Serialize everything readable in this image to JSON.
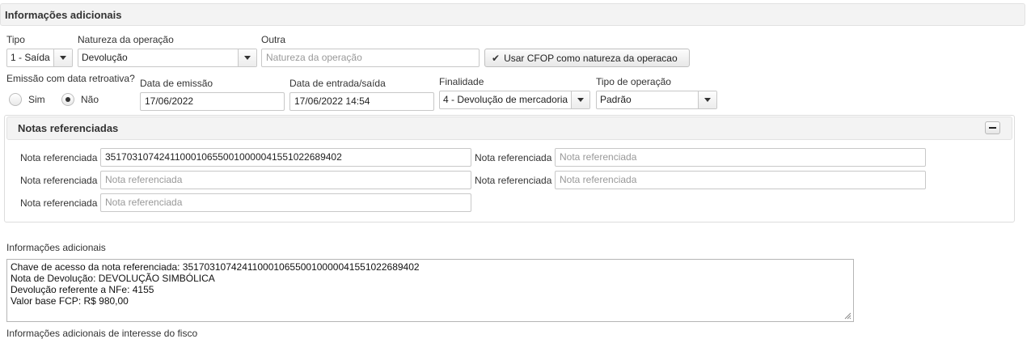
{
  "header": {
    "title": "Informações adicionais"
  },
  "tipo": {
    "label": "Tipo",
    "value": "1 - Saída"
  },
  "natureza": {
    "label": "Natureza da operação",
    "value": "Devolução"
  },
  "outra": {
    "label": "Outra",
    "placeholder": "Natureza da operação"
  },
  "cfop_button": {
    "label": "Usar CFOP como natureza da operacao"
  },
  "retroativa": {
    "label": "Emissão com data retroativa?",
    "options": [
      {
        "label": "Sim",
        "selected": false
      },
      {
        "label": "Não",
        "selected": true
      }
    ]
  },
  "data_emissao": {
    "label": "Data de emissão",
    "value": "17/06/2022"
  },
  "data_entrada": {
    "label": "Data de entrada/saída",
    "value": "17/06/2022 14:54"
  },
  "finalidade": {
    "label": "Finalidade",
    "value": "4 - Devolução de mercadoria"
  },
  "tipo_operacao": {
    "label": "Tipo de operação",
    "value": "Padrão"
  },
  "notas": {
    "title": "Notas referenciadas",
    "field_label": "Nota referenciada",
    "placeholder": "Nota referenciada",
    "fields": [
      {
        "value": "35170310742411000106550010000041551022689402"
      },
      {
        "value": ""
      },
      {
        "value": ""
      },
      {
        "value": ""
      },
      {
        "value": ""
      }
    ]
  },
  "info_adicionais": {
    "label": "Informações adicionais",
    "lines": [
      "Chave de acesso da nota referenciada: 35170310742411000106550010000041551022689402",
      "Nota de Devolução: DEVOLUÇÃO SIMBÓLICA",
      "Devolução referente a NFe: 4155",
      "Valor base FCP: R$ 980,00"
    ]
  },
  "info_fisco": {
    "label": "Informações adicionais de interesse do fisco"
  }
}
